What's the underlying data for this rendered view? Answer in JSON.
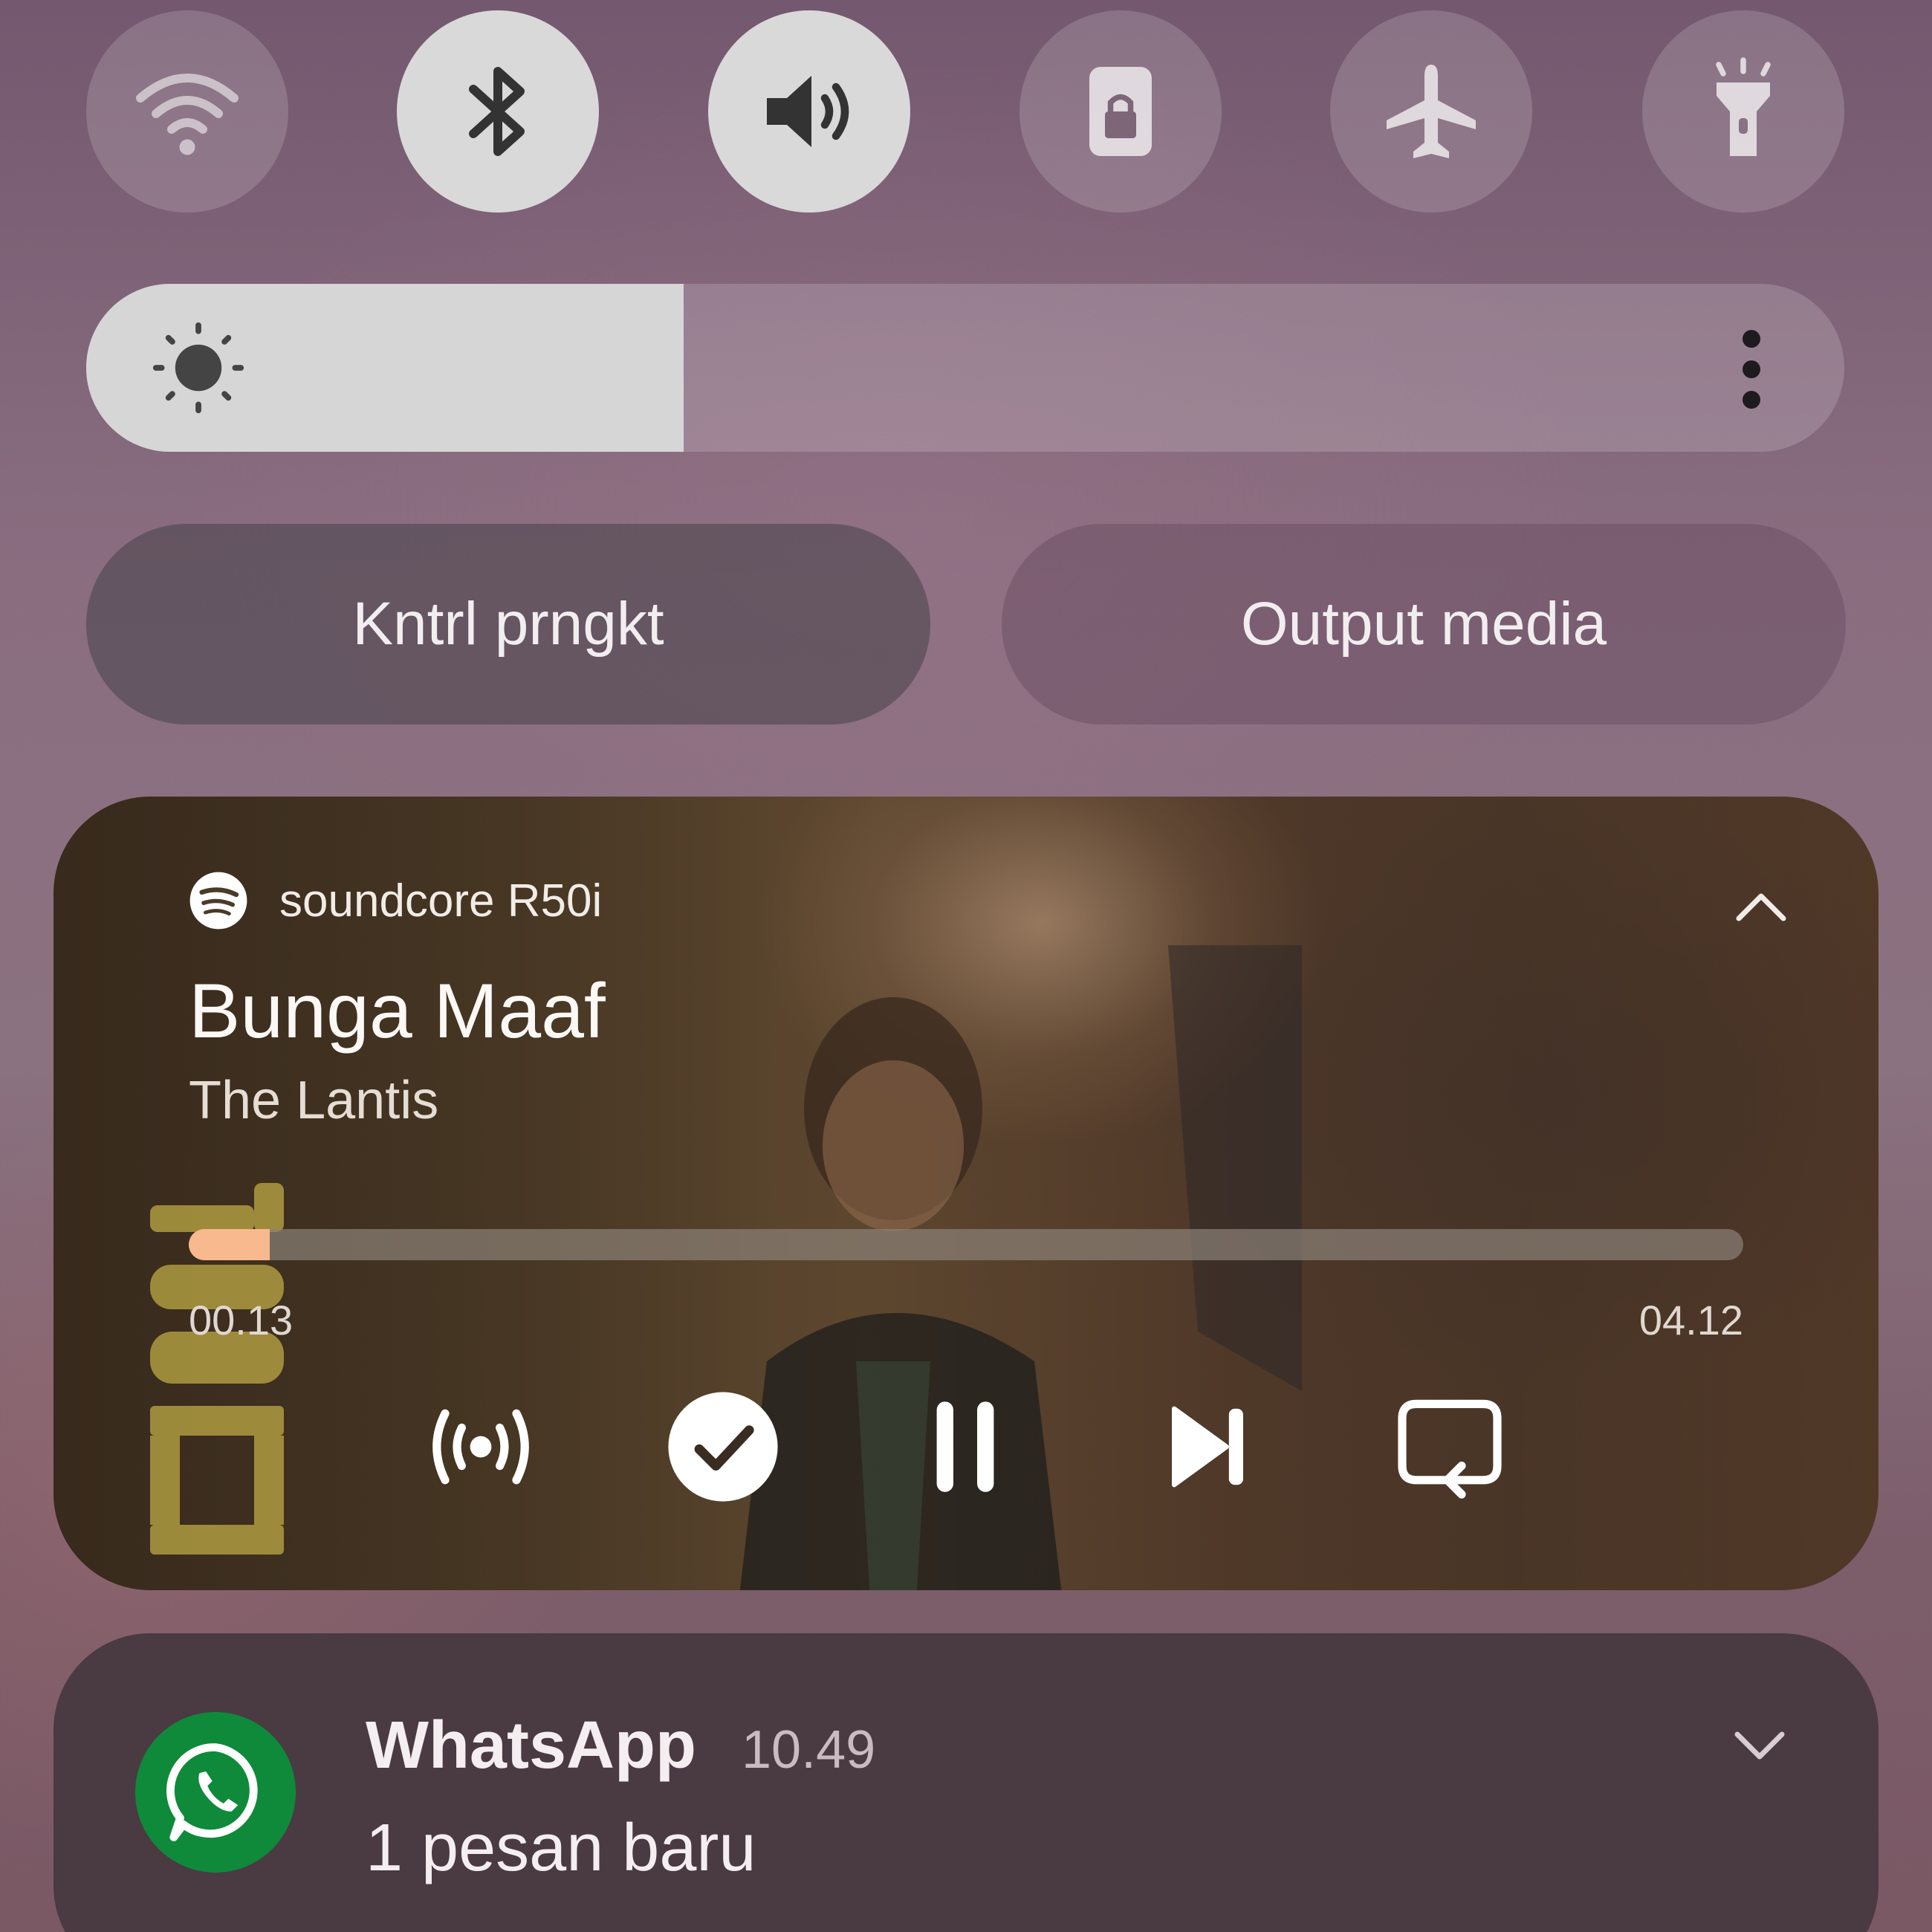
{
  "quick_toggles": [
    {
      "name": "wifi",
      "icon": "wifi-icon",
      "active": false
    },
    {
      "name": "bluetooth",
      "icon": "bluetooth-icon",
      "active": true
    },
    {
      "name": "sound",
      "icon": "volume-icon",
      "active": true
    },
    {
      "name": "rotation-lock",
      "icon": "lock-icon",
      "active": false
    },
    {
      "name": "airplane-mode",
      "icon": "airplane-icon",
      "active": false
    },
    {
      "name": "flashlight",
      "icon": "flashlight-icon",
      "active": false
    }
  ],
  "brightness": {
    "level": 0.34,
    "icon": "sun-icon",
    "menu_icon": "more-vert-icon"
  },
  "buttons": {
    "device_control": "Kntrl prngkt",
    "media_output": "Output media"
  },
  "media": {
    "app_icon": "spotify-icon",
    "device": "soundcore R50i",
    "title": "Bunga Maaf",
    "artist": "The Lantis",
    "current_time": "00.13",
    "duration": "04.12",
    "progress": 0.052,
    "controls": [
      "broadcast-icon",
      "check-circle-icon",
      "pause-icon",
      "skip-next-icon",
      "repeat-icon"
    ],
    "accent": "#f7b98d"
  },
  "notification": {
    "app": "WhatsApp",
    "time": "10.49",
    "text": "1 pesan baru",
    "accent": "#0f8a3a"
  }
}
